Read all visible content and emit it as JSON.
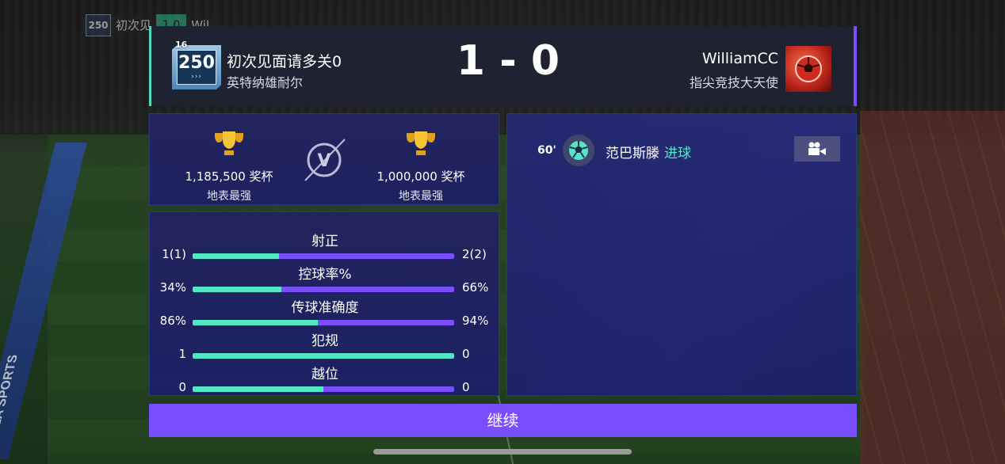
{
  "mini_score": {
    "badge": "250",
    "home": "初次见",
    "score": "1 0",
    "away": "Wil"
  },
  "header": {
    "home": {
      "rank_level": "16",
      "rank_value": "250",
      "name": "初次见面请多关0",
      "club": "英特纳雄耐尔"
    },
    "score": "1 - 0",
    "away": {
      "name": "WilliamCC",
      "club": "指尖竞技大天使"
    }
  },
  "trophies": {
    "home": {
      "value": "1,185,500 奖杯",
      "sub": "地表最强"
    },
    "away": {
      "value": "1,000,000 奖杯",
      "sub": "地表最强"
    },
    "vs_icon": "versus-icon"
  },
  "stats": [
    {
      "label": "射正",
      "home": "1(1)",
      "away": "2(2)",
      "home_share": 0.33
    },
    {
      "label": "控球率%",
      "home": "34%",
      "away": "66%",
      "home_share": 0.34
    },
    {
      "label": "传球准确度",
      "home": "86%",
      "away": "94%",
      "home_share": 0.478
    },
    {
      "label": "犯规",
      "home": "1",
      "away": "0",
      "home_share": 1.0
    },
    {
      "label": "越位",
      "home": "0",
      "away": "0",
      "home_share": 0.5
    }
  ],
  "events": [
    {
      "minute": "60'",
      "player": "范巴斯滕",
      "type": "进球",
      "icon": "soccer-ball-icon"
    }
  ],
  "continue_label": "继续",
  "colors": {
    "accent": "#7a4dff",
    "teal": "#52e8c6",
    "panel": "#1c2260"
  },
  "background": {
    "ad_text": "EA SPORTS"
  }
}
